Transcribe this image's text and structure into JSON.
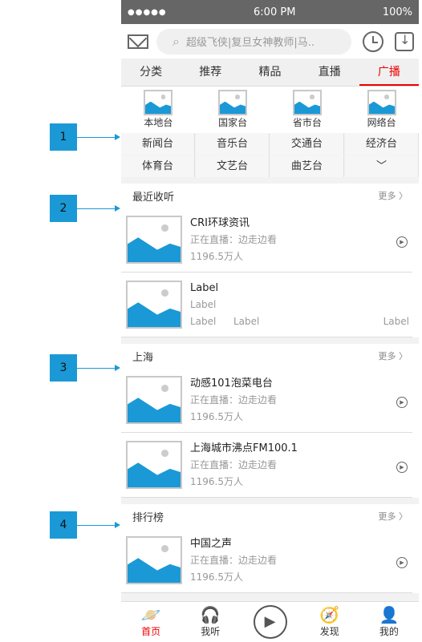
{
  "status": {
    "time": "6:00 PM",
    "battery": "100%",
    "dots": "●●●●●"
  },
  "search": {
    "placeholder": "超级飞侠|复旦女神教师|马.."
  },
  "tabs": [
    "分类",
    "推荐",
    "精品",
    "直播",
    "广播"
  ],
  "categories": [
    "本地台",
    "国家台",
    "省市台",
    "网络台"
  ],
  "grid": [
    "新闻台",
    "音乐台",
    "交通台",
    "经济台",
    "体育台",
    "文艺台",
    "曲艺台",
    "﹀"
  ],
  "sections": {
    "recent": {
      "title": "最近收听",
      "more": "更多 〉",
      "items": [
        {
          "title": "CRI环球资讯",
          "status": "正在直播：边走边看",
          "count": "1196.5万人"
        },
        {
          "title": "Label",
          "status": "Label",
          "l1": "Label",
          "l2": "Label",
          "l3": "Label"
        }
      ]
    },
    "shanghai": {
      "title": "上海",
      "more": "更多 〉",
      "items": [
        {
          "title": "动感101泡菜电台",
          "status": "正在直播：边走边看",
          "count": "1196.5万人"
        },
        {
          "title": "上海城市沸点FM100.1",
          "status": "正在直播：边走边看",
          "count": "1196.5万人"
        }
      ]
    },
    "rank": {
      "title": "排行榜",
      "more": "更多 〉",
      "items": [
        {
          "title": "中国之声",
          "status": "正在直播：边走边看",
          "count": "1196.5万人"
        }
      ]
    }
  },
  "tabbar": [
    "首页",
    "我听",
    "",
    "发现",
    "我的"
  ],
  "callouts": [
    "1",
    "2",
    "3",
    "4"
  ]
}
